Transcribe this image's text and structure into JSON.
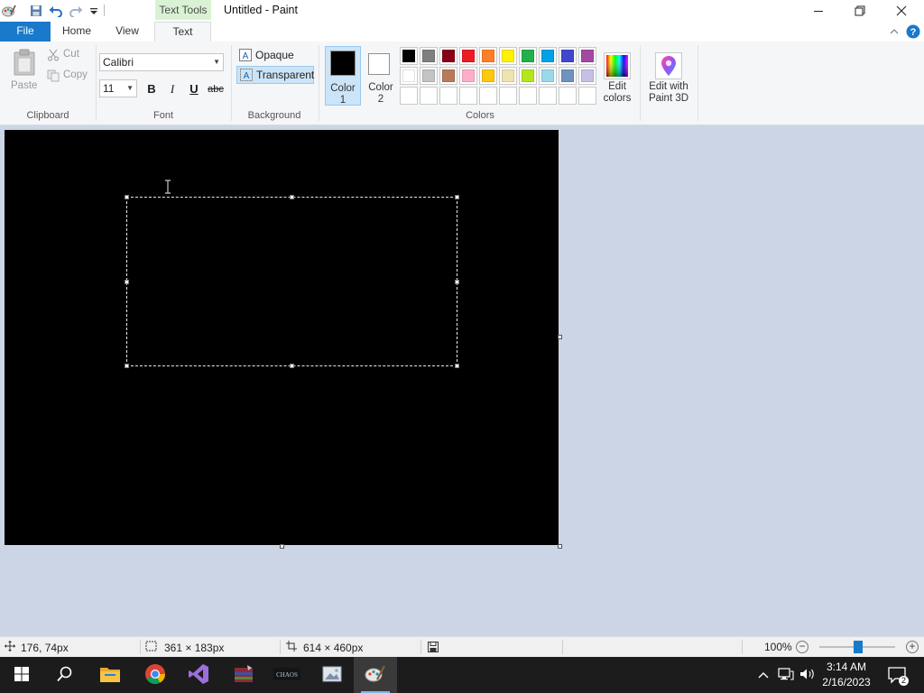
{
  "window": {
    "title": "Untitled - Paint",
    "contextual_tab": "Text Tools"
  },
  "tabs": {
    "file": "File",
    "home": "Home",
    "view": "View",
    "text": "Text"
  },
  "clipboard": {
    "paste": "Paste",
    "cut": "Cut",
    "copy": "Copy",
    "group_label": "Clipboard"
  },
  "font": {
    "family": "Calibri",
    "size": "11",
    "bold": "B",
    "italic": "I",
    "underline": "U",
    "strikethrough": "abc",
    "group_label": "Font"
  },
  "background": {
    "opaque": "Opaque",
    "transparent": "Transparent",
    "selected": "Transparent",
    "group_label": "Background"
  },
  "colors": {
    "color1_label_line1": "Color",
    "color1_label_line2": "1",
    "color1_value": "#000000",
    "color2_label_line1": "Color",
    "color2_label_line2": "2",
    "color2_value": "#ffffff",
    "palette_row1": [
      "#000000",
      "#7f7f7f",
      "#880015",
      "#ed1c24",
      "#ff7f27",
      "#fff200",
      "#22b14c",
      "#00a2e8",
      "#3f48cc",
      "#a349a4"
    ],
    "palette_row2": [
      "#ffffff",
      "#c3c3c3",
      "#b97a57",
      "#ffaec9",
      "#ffc90e",
      "#efe4b0",
      "#b5e61d",
      "#99d9ea",
      "#7092be",
      "#c8bfe7"
    ],
    "palette_row3": [
      "",
      "",
      "",
      "",
      "",
      "",
      "",
      "",
      "",
      ""
    ],
    "edit_colors_line1": "Edit",
    "edit_colors_line2": "colors",
    "group_label": "Colors"
  },
  "paint3d": {
    "line1": "Edit with",
    "line2": "Paint 3D"
  },
  "status": {
    "cursor_pos": "176, 74px",
    "selection_size": "361 × 183px",
    "canvas_size": "614 × 460px",
    "zoom": "100%",
    "zoom_level": 1.0
  },
  "taskbar": {
    "apps": [
      "start-icon",
      "search-icon",
      "file-explorer-icon",
      "chrome-icon",
      "visual-studio-icon",
      "winrar-icon",
      "chaos-app-icon",
      "photo-viewer-icon",
      "paint-icon"
    ],
    "active_app": "paint-icon",
    "time": "3:14 AM",
    "date": "2/16/2023",
    "notification_count": "2"
  },
  "accent": "#1979ca",
  "workspace_bg": "#cbd5e6",
  "canvas_bg": "#000000"
}
